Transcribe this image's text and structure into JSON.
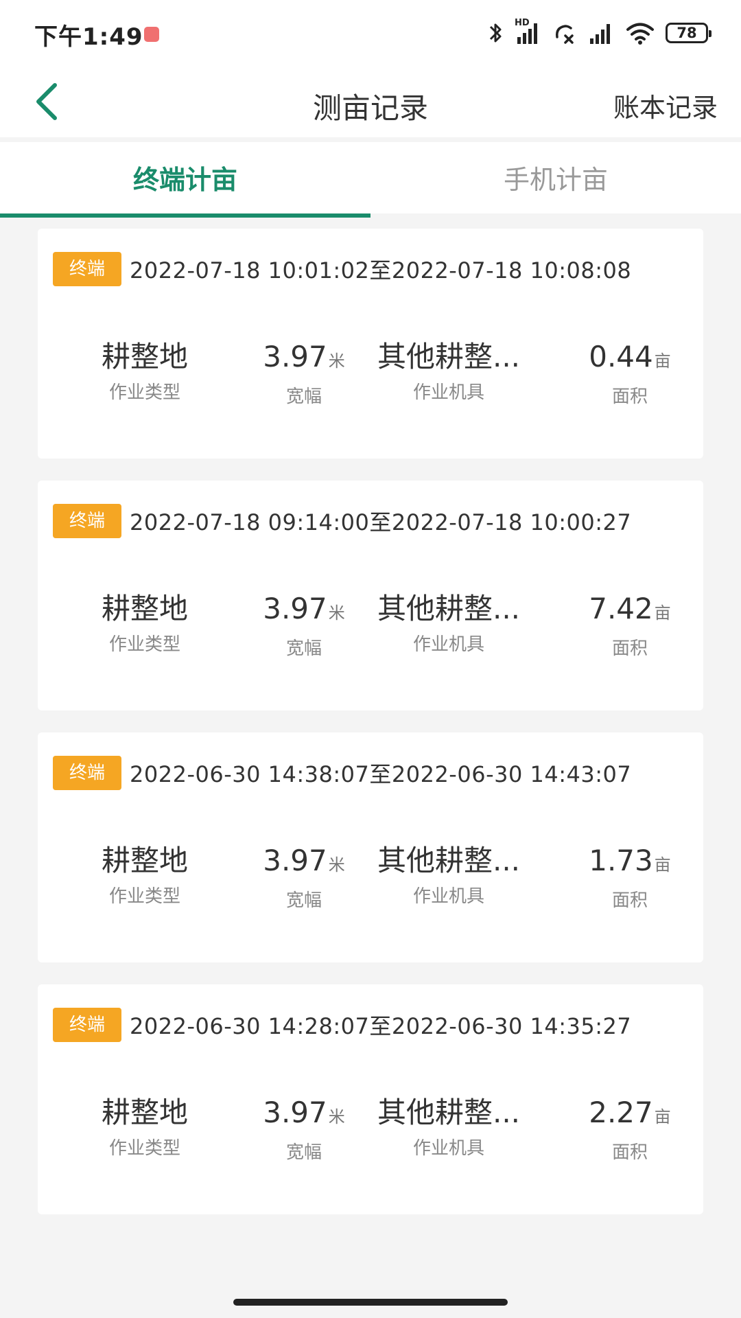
{
  "status": {
    "time": "下午1:49",
    "battery": "78",
    "hd_label": "HD"
  },
  "header": {
    "title": "测亩记录",
    "right_action": "账本记录"
  },
  "tabs": [
    {
      "label": "终端计亩",
      "active": true
    },
    {
      "label": "手机计亩",
      "active": false
    }
  ],
  "records": [
    {
      "badge": "终端",
      "time_range": "2022-07-18 10:01:02至2022-07-18 10:08:08",
      "job_type": "耕整地",
      "job_type_label": "作业类型",
      "width": "3.97",
      "width_unit": "米",
      "width_label": "宽幅",
      "tool": "其他耕整...",
      "tool_label": "作业机具",
      "area": "0.44",
      "area_unit": "亩",
      "area_label": "面积"
    },
    {
      "badge": "终端",
      "time_range": "2022-07-18 09:14:00至2022-07-18 10:00:27",
      "job_type": "耕整地",
      "job_type_label": "作业类型",
      "width": "3.97",
      "width_unit": "米",
      "width_label": "宽幅",
      "tool": "其他耕整...",
      "tool_label": "作业机具",
      "area": "7.42",
      "area_unit": "亩",
      "area_label": "面积"
    },
    {
      "badge": "终端",
      "time_range": "2022-06-30 14:38:07至2022-06-30 14:43:07",
      "job_type": "耕整地",
      "job_type_label": "作业类型",
      "width": "3.97",
      "width_unit": "米",
      "width_label": "宽幅",
      "tool": "其他耕整...",
      "tool_label": "作业机具",
      "area": "1.73",
      "area_unit": "亩",
      "area_label": "面积"
    },
    {
      "badge": "终端",
      "time_range": "2022-06-30 14:28:07至2022-06-30 14:35:27",
      "job_type": "耕整地",
      "job_type_label": "作业类型",
      "width": "3.97",
      "width_unit": "米",
      "width_label": "宽幅",
      "tool": "其他耕整...",
      "tool_label": "作业机具",
      "area": "2.27",
      "area_unit": "亩",
      "area_label": "面积"
    }
  ],
  "colors": {
    "accent": "#1a8c6b",
    "badge": "#f5a623",
    "background": "#f4f4f4"
  },
  "icons": [
    "back-chevron-icon",
    "bluetooth-icon",
    "cellular-signal-icon",
    "call-icon",
    "wifi-icon",
    "battery-icon"
  ]
}
